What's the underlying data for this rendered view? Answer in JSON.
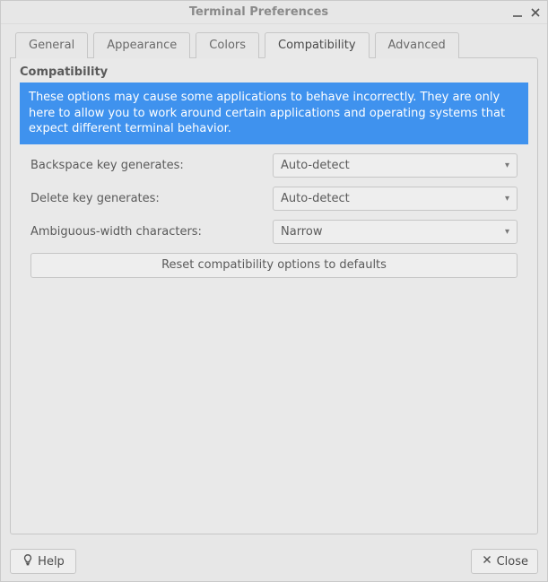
{
  "window": {
    "title": "Terminal Preferences"
  },
  "tabs": {
    "items": [
      {
        "label": "General"
      },
      {
        "label": "Appearance"
      },
      {
        "label": "Colors"
      },
      {
        "label": "Compatibility"
      },
      {
        "label": "Advanced"
      }
    ],
    "active_index": 3
  },
  "compat": {
    "section_title": "Compatibility",
    "info_text": "These options may cause some applications to behave incorrectly. They are only here to allow you to work around certain applications and operating systems that expect different terminal behavior.",
    "fields": {
      "backspace": {
        "label": "Backspace key generates:",
        "value": "Auto-detect"
      },
      "delete": {
        "label": "Delete key generates:",
        "value": "Auto-detect"
      },
      "ambiguous": {
        "label": "Ambiguous-width characters:",
        "value": "Narrow"
      }
    },
    "reset_label": "Reset compatibility options to defaults"
  },
  "footer": {
    "help_label": "Help",
    "close_label": "Close"
  }
}
